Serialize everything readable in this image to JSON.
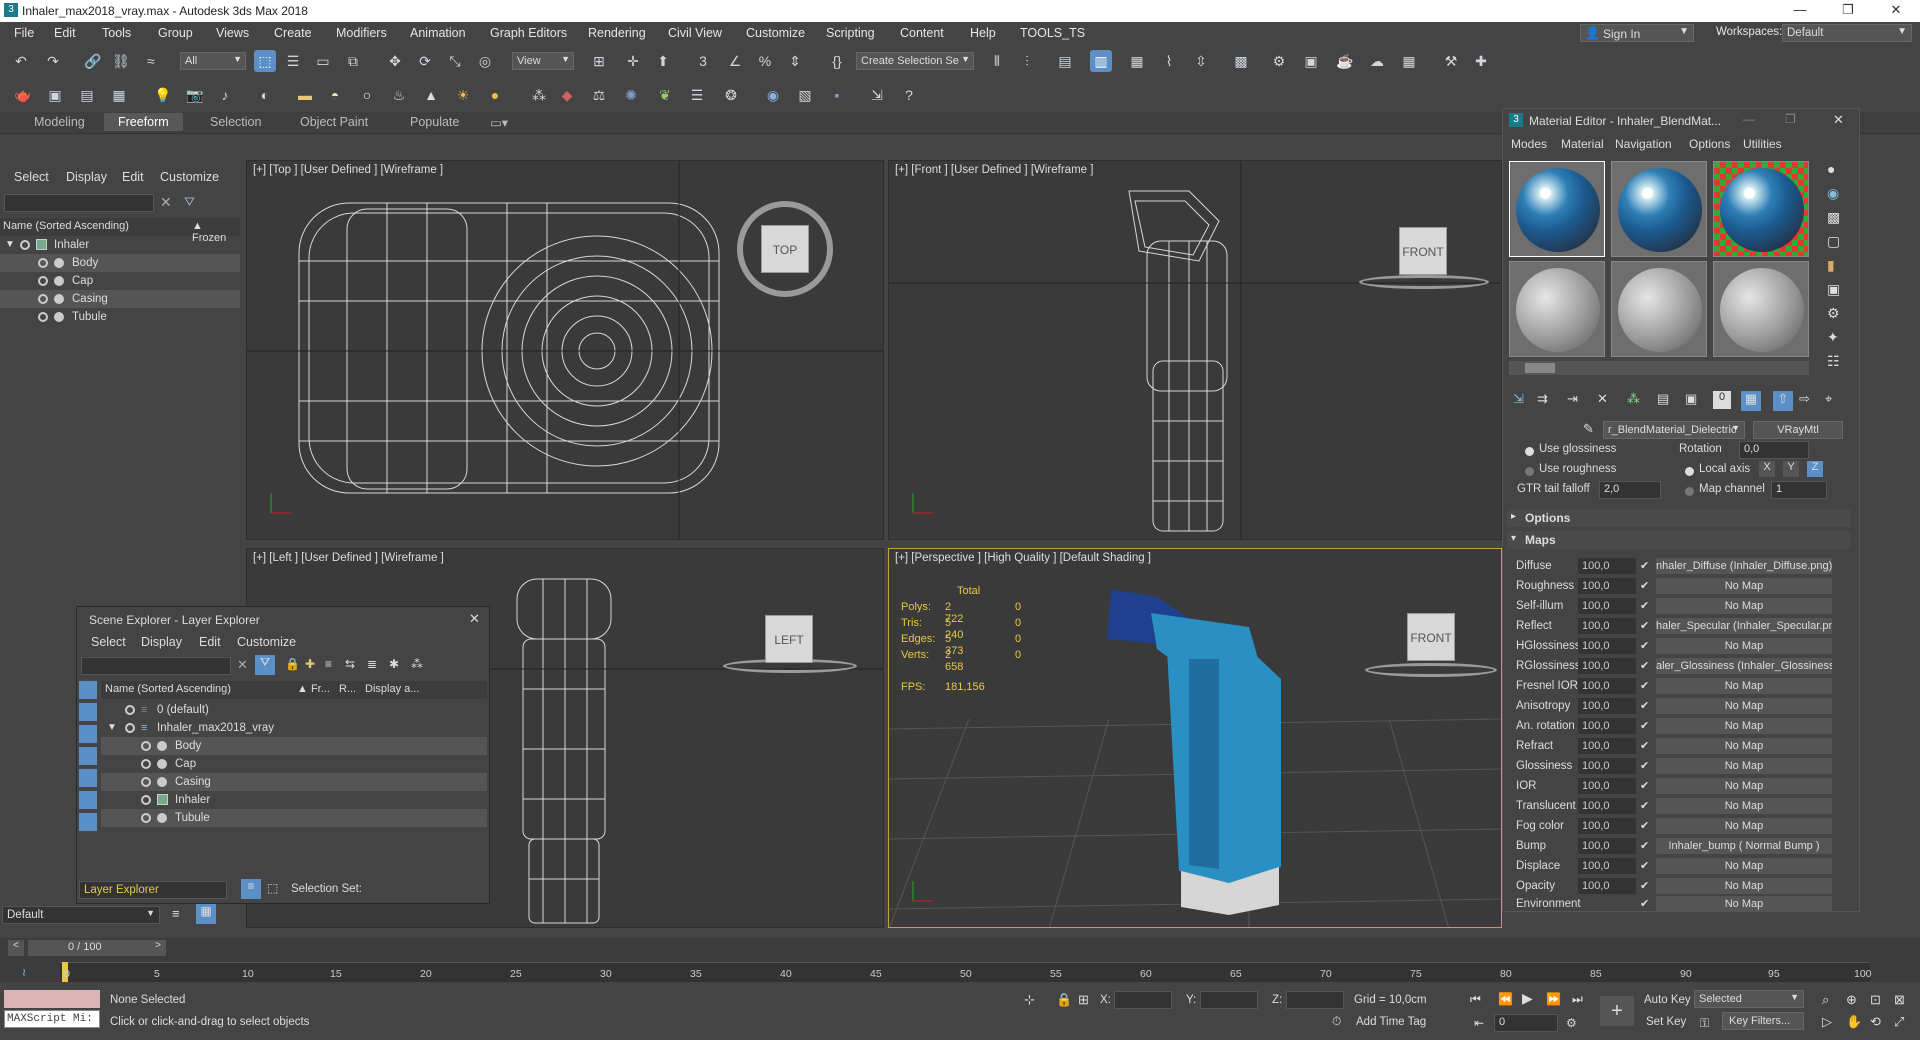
{
  "title": {
    "text": "Inhaler_max2018_vray.max - Autodesk 3ds Max 2018",
    "minimize": "—",
    "maximize": "❐",
    "close": "✕"
  },
  "menus": [
    "File",
    "Edit",
    "Tools",
    "Group",
    "Views",
    "Create",
    "Modifiers",
    "Animation",
    "Graph Editors",
    "Rendering",
    "Civil View",
    "Customize",
    "Scripting",
    "Content",
    "Help",
    "TOOLS_TS"
  ],
  "signin": "Sign In",
  "workspaces_label": "Workspaces:",
  "workspace": "Default",
  "toolbar": {
    "filter": "All",
    "view": "View",
    "create_selection": "Create Selection Se"
  },
  "ribbon": [
    "Modeling",
    "Freeform",
    "Selection",
    "Object Paint",
    "Populate"
  ],
  "ribbon_active": "Freeform",
  "left": {
    "tabs": [
      "Select",
      "Display",
      "Edit",
      "Customize"
    ],
    "col_name": "Name (Sorted Ascending)",
    "col_frozen": "▲ Frozen",
    "root": "Inhaler",
    "items": [
      "Body",
      "Cap",
      "Casing",
      "Tubule"
    ]
  },
  "layer_explorer": {
    "title": "Scene Explorer - Layer Explorer",
    "tabs": [
      "Select",
      "Display",
      "Edit",
      "Customize"
    ],
    "cols": [
      "Name (Sorted Ascending)",
      "▲ Fr...",
      "R...",
      "Display a..."
    ],
    "rows": [
      {
        "name": "0 (default)",
        "level": 1
      },
      {
        "name": "Inhaler_max2018_vray",
        "level": 1
      },
      {
        "name": "Body",
        "level": 2
      },
      {
        "name": "Cap",
        "level": 2
      },
      {
        "name": "Casing",
        "level": 2
      },
      {
        "name": "Inhaler",
        "level": 2
      },
      {
        "name": "Tubule",
        "level": 2
      }
    ],
    "footer": "Layer Explorer",
    "selection_set": "Selection Set:"
  },
  "viewports": {
    "top": "[+] [Top ] [User Defined ] [Wireframe ]",
    "front": "[+] [Front ] [User Defined ] [Wireframe ]",
    "left": "[+] [Left ] [User Defined ] [Wireframe ]",
    "persp": "[+] [Perspective ] [High Quality ] [Default Shading ]"
  },
  "cubes": {
    "top": "TOP",
    "front": "FRONT",
    "left": "LEFT",
    "persp": "FRONT"
  },
  "stats": {
    "header": "Total",
    "rows": [
      {
        "k": "Polys:",
        "v": "2 722",
        "z": "0"
      },
      {
        "k": "Tris:",
        "v": "5 240",
        "z": "0"
      },
      {
        "k": "Edges:",
        "v": "5 373",
        "z": "0"
      },
      {
        "k": "Verts:",
        "v": "2 658",
        "z": "0"
      }
    ],
    "fps_label": "FPS:",
    "fps": "181,156"
  },
  "mat": {
    "title": "Material Editor - Inhaler_BlendMat...",
    "menus": [
      "Modes",
      "Material",
      "Navigation",
      "Options",
      "Utilities"
    ],
    "mat_name": "r_BlendMaterial_Dielectric",
    "mat_type": "VRayMtl",
    "use_gloss": "Use glossiness",
    "use_rough": "Use roughness",
    "rotation": "Rotation",
    "rot_val": "0,0",
    "local_axis": "Local axis",
    "gtr": "GTR tail falloff",
    "gtr_val": "2,0",
    "map_channel": "Map channel",
    "map_channel_val": "1",
    "options": "Options",
    "maps": "Maps",
    "axes": [
      "X",
      "Y",
      "Z"
    ]
  },
  "maps": [
    {
      "l": "Diffuse",
      "v": "100,0",
      "m": "nhaler_Diffuse (Inhaler_Diffuse.png)"
    },
    {
      "l": "Roughness",
      "v": "100,0",
      "m": "No Map"
    },
    {
      "l": "Self-illum",
      "v": "100,0",
      "m": "No Map"
    },
    {
      "l": "Reflect",
      "v": "100,0",
      "m": "haler_Specular (Inhaler_Specular.png"
    },
    {
      "l": "HGlossiness",
      "v": "100,0",
      "m": "No Map"
    },
    {
      "l": "RGlossiness",
      "v": "100,0",
      "m": "aler_Glossiness (Inhaler_Glossiness.p"
    },
    {
      "l": "Fresnel IOR",
      "v": "100,0",
      "m": "No Map"
    },
    {
      "l": "Anisotropy",
      "v": "100,0",
      "m": "No Map"
    },
    {
      "l": "An. rotation",
      "v": "100,0",
      "m": "No Map"
    },
    {
      "l": "Refract",
      "v": "100,0",
      "m": "No Map"
    },
    {
      "l": "Glossiness",
      "v": "100,0",
      "m": "No Map"
    },
    {
      "l": "IOR",
      "v": "100,0",
      "m": "No Map"
    },
    {
      "l": "Translucent",
      "v": "100,0",
      "m": "No Map"
    },
    {
      "l": "Fog color",
      "v": "100,0",
      "m": "No Map"
    },
    {
      "l": "Bump",
      "v": "100,0",
      "m": "Inhaler_bump  ( Normal Bump )"
    },
    {
      "l": "Displace",
      "v": "100,0",
      "m": "No Map"
    },
    {
      "l": "Opacity",
      "v": "100,0",
      "m": "No Map"
    },
    {
      "l": "Environment",
      "v": "",
      "m": "No Map"
    }
  ],
  "timeline": {
    "frame": "0 / 100",
    "ticks": [
      "0",
      "5",
      "10",
      "15",
      "20",
      "25",
      "30",
      "35",
      "40",
      "45",
      "50",
      "55",
      "60",
      "65",
      "70",
      "75",
      "80",
      "85",
      "90",
      "95",
      "100"
    ]
  },
  "status": {
    "default": "Default",
    "maxscript": "MAXScript Mi:",
    "selected": "None Selected",
    "hint": "Click or click-and-drag to select objects",
    "x": "X:",
    "y": "Y:",
    "z": "Z:",
    "grid": "Grid = 10,0cm",
    "addtime": "Add Time Tag",
    "autokey": "Auto Key",
    "setkey": "Set Key",
    "selected_dd": "Selected",
    "keyfilters": "Key Filters...",
    "frame_field": "0"
  },
  "colors": {
    "accent": "#5b8fc7",
    "inhaler_blue": "#2a8fc3",
    "inhaler_dark": "#1f3f8f",
    "stat_yellow": "#e6c84a"
  }
}
